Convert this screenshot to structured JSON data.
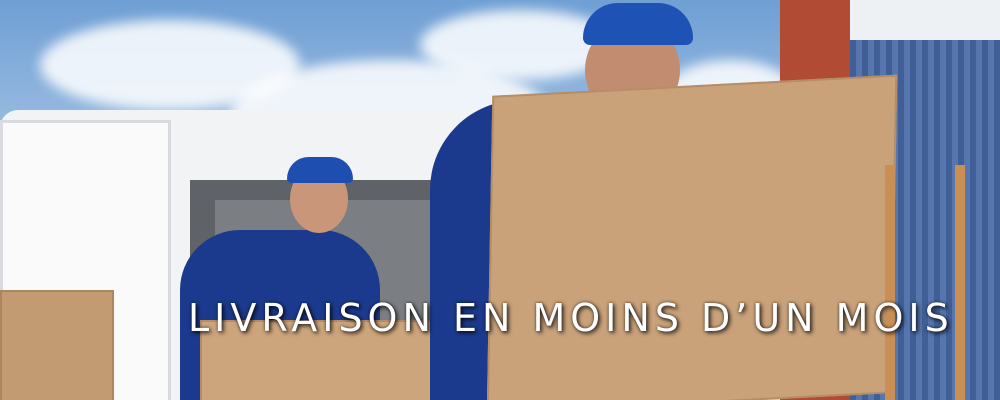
{
  "banner": {
    "headline": "LIVRAISON EN MOINS D’UN MOIS"
  }
}
